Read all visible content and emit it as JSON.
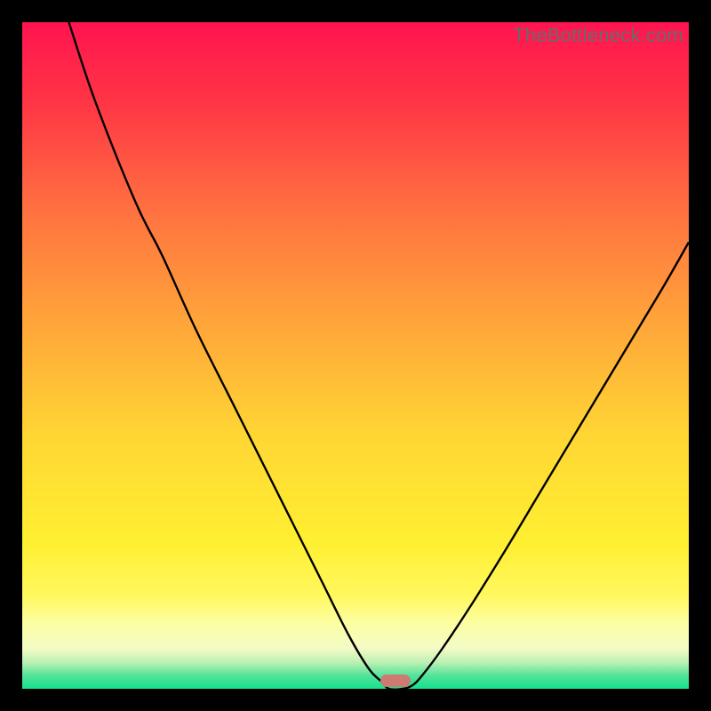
{
  "watermark": "TheBottleneck.com",
  "gradient_stops": [
    {
      "pct": 0,
      "color": "#ff1450"
    },
    {
      "pct": 12,
      "color": "#ff3545"
    },
    {
      "pct": 28,
      "color": "#ff7040"
    },
    {
      "pct": 45,
      "color": "#ffa53a"
    },
    {
      "pct": 62,
      "color": "#ffd634"
    },
    {
      "pct": 78,
      "color": "#ffef31"
    },
    {
      "pct": 86,
      "color": "#fff85e"
    },
    {
      "pct": 90,
      "color": "#fdfea0"
    },
    {
      "pct": 94,
      "color": "#f3fbc6"
    },
    {
      "pct": 96,
      "color": "#bef0b3"
    },
    {
      "pct": 98,
      "color": "#54e39b"
    },
    {
      "pct": 100,
      "color": "#14e28d"
    }
  ],
  "chart_data": {
    "type": "line",
    "title": "",
    "xlabel": "",
    "ylabel": "",
    "xlim": [
      0,
      100
    ],
    "ylim": [
      0,
      100
    ],
    "series": [
      {
        "name": "bottleneck-curve",
        "points": [
          {
            "x": 7,
            "y": 100
          },
          {
            "x": 11,
            "y": 88
          },
          {
            "x": 17,
            "y": 73
          },
          {
            "x": 21,
            "y": 65
          },
          {
            "x": 26,
            "y": 54
          },
          {
            "x": 32,
            "y": 42
          },
          {
            "x": 37,
            "y": 32
          },
          {
            "x": 41,
            "y": 24
          },
          {
            "x": 45,
            "y": 16
          },
          {
            "x": 49,
            "y": 8
          },
          {
            "x": 52,
            "y": 3
          },
          {
            "x": 54,
            "y": 1
          },
          {
            "x": 55,
            "y": 0
          },
          {
            "x": 57,
            "y": 0
          },
          {
            "x": 58.5,
            "y": 0.5
          },
          {
            "x": 60,
            "y": 2
          },
          {
            "x": 63,
            "y": 6
          },
          {
            "x": 67,
            "y": 12
          },
          {
            "x": 72,
            "y": 20
          },
          {
            "x": 78,
            "y": 30
          },
          {
            "x": 84,
            "y": 40
          },
          {
            "x": 90,
            "y": 50
          },
          {
            "x": 96,
            "y": 60
          },
          {
            "x": 100,
            "y": 67
          }
        ]
      }
    ],
    "marker": {
      "x": 56,
      "y": 1.2,
      "color": "#cf7a71"
    }
  },
  "curve_stroke": "#000000",
  "curve_width": 2.4
}
